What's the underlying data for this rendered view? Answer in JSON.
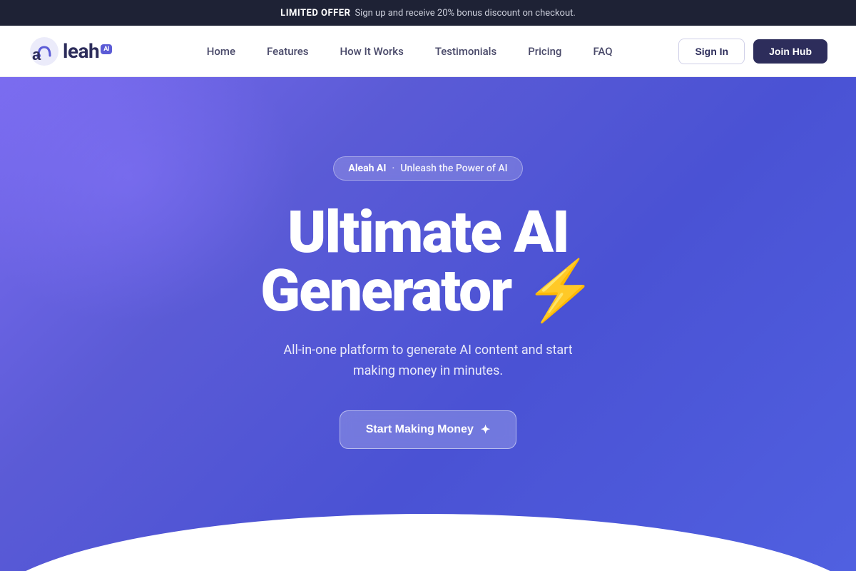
{
  "announcement": {
    "offer_label": "LIMITED OFFER",
    "offer_text": "Sign up and receive 20% bonus discount on checkout."
  },
  "nav": {
    "logo_text": "leah",
    "logo_ai": "AI",
    "links": [
      {
        "label": "Home",
        "id": "home"
      },
      {
        "label": "Features",
        "id": "features"
      },
      {
        "label": "How It Works",
        "id": "how-it-works"
      },
      {
        "label": "Testimonials",
        "id": "testimonials"
      },
      {
        "label": "Pricing",
        "id": "pricing"
      },
      {
        "label": "FAQ",
        "id": "faq"
      }
    ],
    "signin_label": "Sign In",
    "joinhub_label": "Join Hub"
  },
  "hero": {
    "badge_name": "Aleah AI",
    "badge_dot": "·",
    "badge_tagline": "Unleash the Power of AI",
    "title_line1": "Ultimate AI",
    "title_line2": "Generator",
    "lightning": "⚡",
    "subtitle": "All-in-one platform to generate AI content and start making money in minutes.",
    "cta_label": "Start Making Money",
    "cta_icon": "✦"
  }
}
